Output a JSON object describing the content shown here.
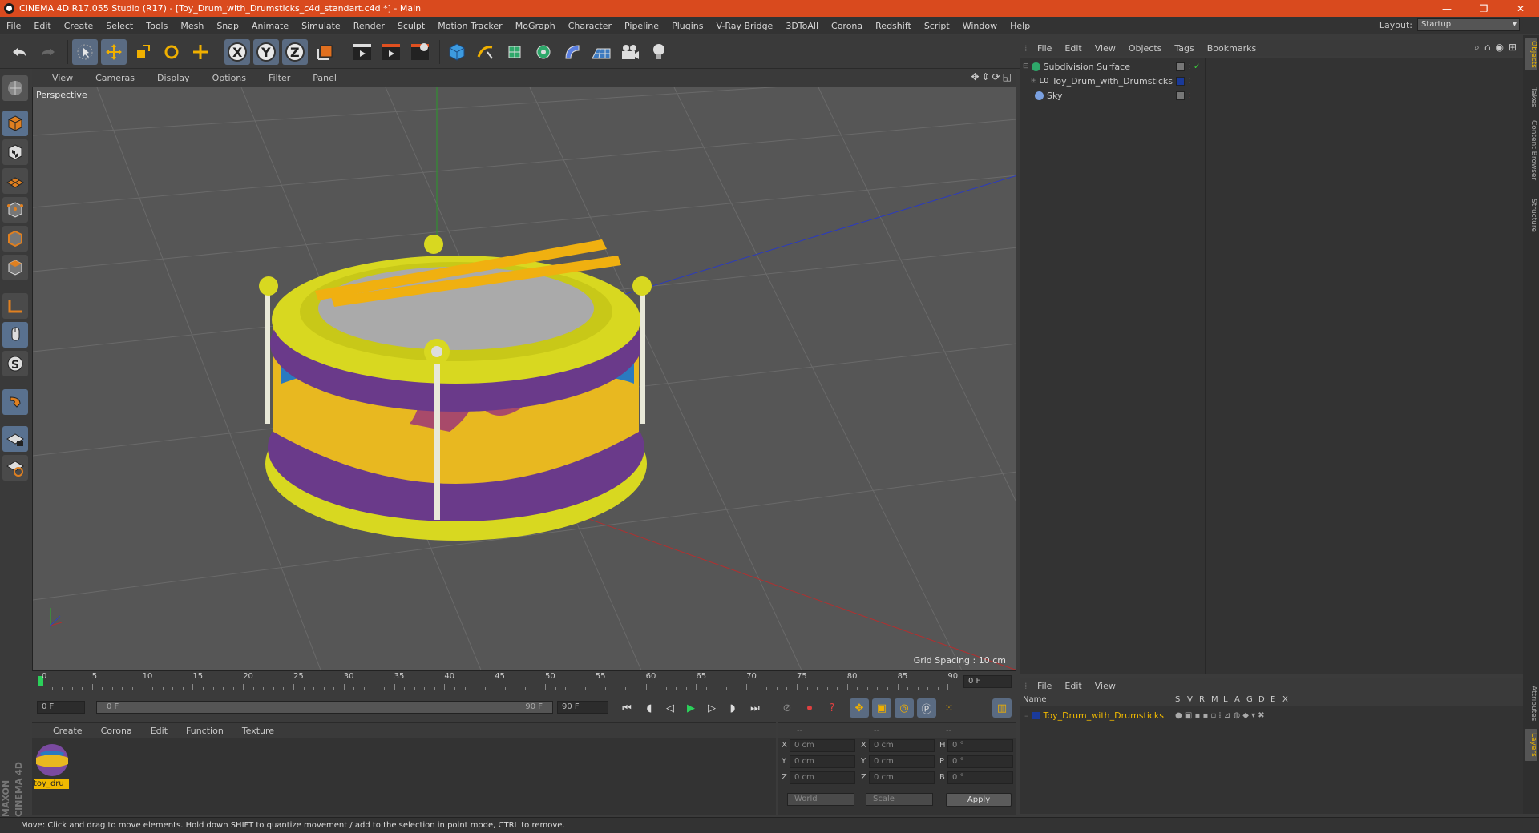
{
  "titlebar": {
    "title": "CINEMA 4D R17.055 Studio (R17) - [Toy_Drum_with_Drumsticks_c4d_standart.c4d *] - Main",
    "minimize": "—",
    "maximize": "❐",
    "close": "✕"
  },
  "menubar": {
    "items": [
      "File",
      "Edit",
      "Create",
      "Select",
      "Tools",
      "Mesh",
      "Snap",
      "Animate",
      "Simulate",
      "Render",
      "Sculpt",
      "Motion Tracker",
      "MoGraph",
      "Character",
      "Pipeline",
      "Plugins",
      "V-Ray Bridge",
      "3DToAll",
      "Corona",
      "Redshift",
      "Script",
      "Window",
      "Help"
    ],
    "layout_label": "Layout:",
    "layout_value": "Startup"
  },
  "viewport": {
    "menu": [
      "View",
      "Cameras",
      "Display",
      "Options",
      "Filter",
      "Panel"
    ],
    "label": "Perspective",
    "grid_spacing": "Grid Spacing : 10 cm"
  },
  "timeline": {
    "ticks": [
      "0",
      "5",
      "10",
      "15",
      "20",
      "25",
      "30",
      "35",
      "40",
      "45",
      "50",
      "55",
      "60",
      "65",
      "70",
      "75",
      "80",
      "85",
      "90"
    ],
    "current_frame": "0 F",
    "start_field": "0 F",
    "range_start": "0 F",
    "range_end": "90 F",
    "end_field": "90 F"
  },
  "material_manager": {
    "menu": [
      "Create",
      "Corona",
      "Edit",
      "Function",
      "Texture"
    ],
    "material_name": "toy_dru"
  },
  "coordinates": {
    "headers": [
      "--",
      "--",
      "--"
    ],
    "rows": [
      {
        "axis": "X",
        "pos": "0 cm",
        "axis2": "X",
        "size": "0 cm",
        "axis3": "H",
        "rot": "0 °"
      },
      {
        "axis": "Y",
        "pos": "0 cm",
        "axis2": "Y",
        "size": "0 cm",
        "axis3": "P",
        "rot": "0 °"
      },
      {
        "axis": "Z",
        "pos": "0 cm",
        "axis2": "Z",
        "size": "0 cm",
        "axis3": "B",
        "rot": "0 °"
      }
    ],
    "world_dropdown": "World",
    "scale_dropdown": "Scale",
    "apply": "Apply"
  },
  "object_manager": {
    "menu": [
      "File",
      "Edit",
      "View",
      "Objects",
      "Tags",
      "Bookmarks"
    ],
    "objects": [
      {
        "name": "Subdivision Surface"
      },
      {
        "name": "Toy_Drum_with_Drumsticks"
      },
      {
        "name": "Sky"
      }
    ]
  },
  "layer_manager": {
    "menu": [
      "File",
      "Edit",
      "View"
    ],
    "columns": [
      "Name",
      "S",
      "V",
      "R",
      "M",
      "L",
      "A",
      "G",
      "D",
      "E",
      "X"
    ],
    "layer_name": "Toy_Drum_with_Drumsticks",
    "layer_color": "#1a3a9a"
  },
  "right_tabs": [
    "Objects",
    "Takes",
    "Content Browser",
    "Structure"
  ],
  "right_tabs_bottom": [
    "Attributes",
    "Layers"
  ],
  "statusbar": {
    "text": "Move: Click and drag to move elements. Hold down SHIFT to quantize movement / add to the selection in point mode, CTRL to remove."
  },
  "branding": {
    "logo_text": "MAXON CINEMA 4D"
  },
  "colors": {
    "accent": "#d94a1e",
    "highlight": "#f0b900",
    "selection": "#5a6b82"
  }
}
